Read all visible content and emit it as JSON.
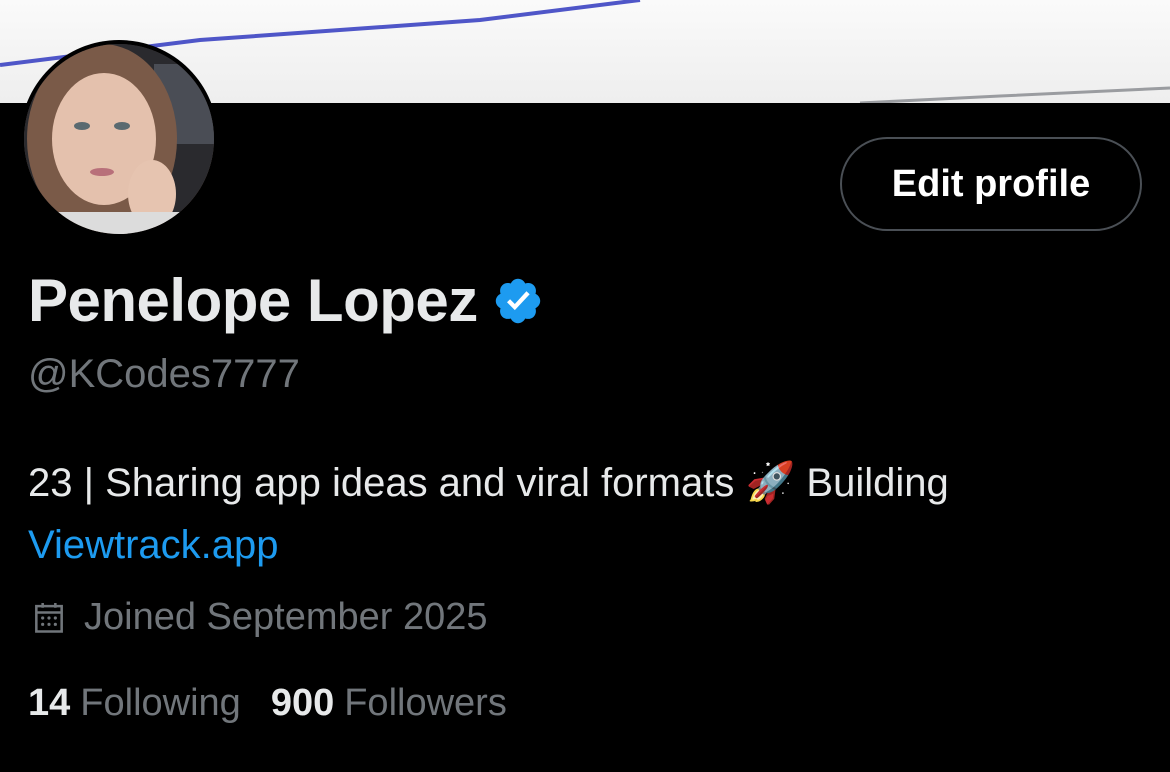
{
  "profile": {
    "name": "Penelope Lopez",
    "handle": "@KCodes7777",
    "bio_text": "23 | Sharing app ideas and viral formats",
    "bio_emoji": "🚀",
    "bio_after_emoji": " Building",
    "bio_link": "Viewtrack.app",
    "joined": "Joined September 2025",
    "edit_button_label": "Edit profile"
  },
  "stats": {
    "following_count": "14",
    "following_label": "Following",
    "followers_count": "900",
    "followers_label": "Followers"
  },
  "icons": {
    "verified": "verified-badge-icon",
    "calendar": "calendar-icon"
  },
  "colors": {
    "background": "#000000",
    "primary_text": "#e7e9ea",
    "secondary_text": "#71767b",
    "link": "#1d9bf0",
    "verified": "#1d9bf0",
    "button_border": "#4a4f55"
  }
}
